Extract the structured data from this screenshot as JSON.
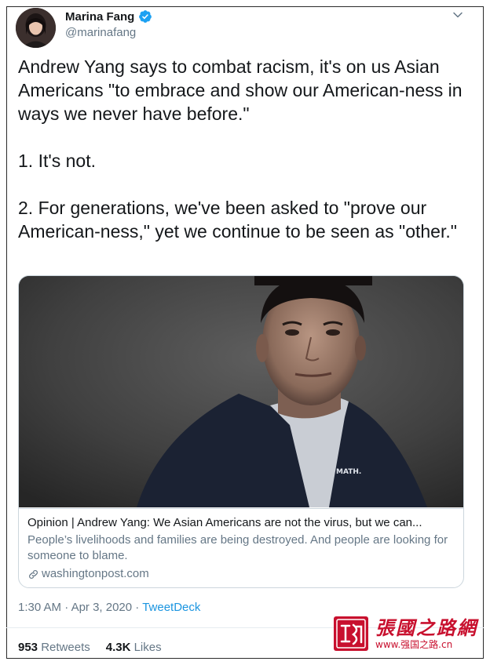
{
  "author": {
    "name": "Marina Fang",
    "handle": "@marinafang",
    "verified": true
  },
  "tweet": {
    "paragraphs": [
      "Andrew Yang says to combat racism, it's on us Asian Americans \"to embrace and show our American-ness in ways we never have before.\"",
      "1. It's not.",
      "2. For generations, we've been asked to \"prove our American-ness,\" yet we continue to be seen as \"other.\""
    ]
  },
  "card": {
    "image_caption_text": "MATH.",
    "title": "Opinion | Andrew Yang: We Asian Americans are not the virus, but we can...",
    "description": "People’s livelihoods and families are being destroyed. And people are looking for someone to blame.",
    "domain": "washingtonpost.com"
  },
  "meta": {
    "time": "1:30 AM",
    "separator1": " · ",
    "date": "Apr 3, 2020",
    "separator2": " · ",
    "source": "TweetDeck"
  },
  "stats": {
    "retweets_count": "953",
    "retweets_label": "Retweets",
    "likes_count": "4.3K",
    "likes_label": "Likes"
  },
  "watermark": {
    "title": "張國之路網",
    "url": "www.强国之路.cn"
  },
  "colors": {
    "link_blue": "#1b95e0",
    "secondary_text": "#657786",
    "watermark_red": "#c8102e"
  },
  "icons": {
    "verified": "verified-badge-icon",
    "chevron": "chevron-down-icon",
    "link": "link-icon"
  }
}
